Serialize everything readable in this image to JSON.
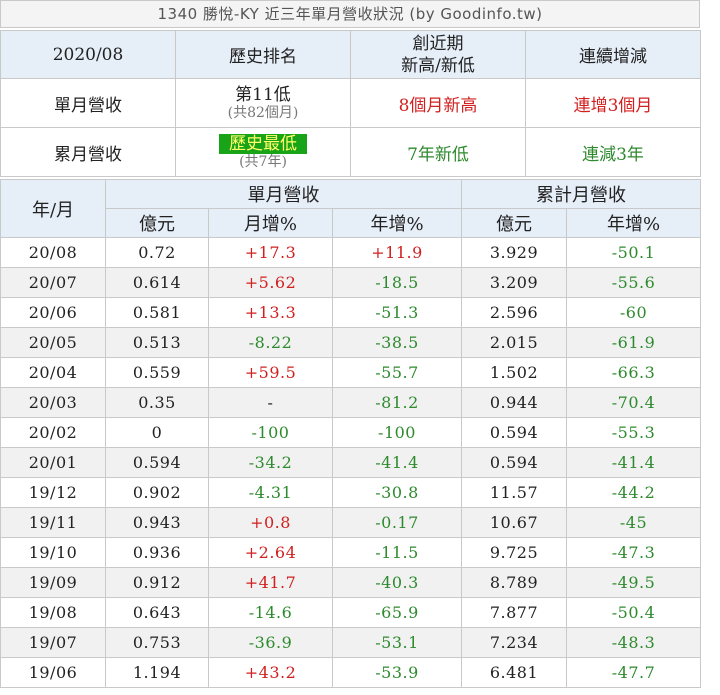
{
  "title": "1340 勝悅-KY 近三年單月營收狀況 (by Goodinfo.tw)",
  "summary": {
    "period": "2020/08",
    "headers": [
      "歷史排名",
      "創近期\n新高/新低",
      "連續增減"
    ],
    "header_line1": "創近期",
    "header_line2": "新高/新低",
    "monthly": {
      "label": "單月營收",
      "rank_main": "第11低",
      "rank_sub": "(共82個月)",
      "recent": "8個月新高",
      "streak": "連增3個月"
    },
    "cumulative": {
      "label": "累月營收",
      "rank_main": "歷史最低",
      "rank_sub": "(共7年)",
      "recent": "7年新低",
      "streak": "連減3年"
    }
  },
  "table": {
    "col_period": "年/月",
    "group_monthly": "單月營收",
    "group_cumulative": "累計月營收",
    "sub_headers": [
      "億元",
      "月增%",
      "年增%",
      "億元",
      "年增%"
    ],
    "rows": [
      {
        "period": "20/08",
        "rev": "0.72",
        "mom": "+17.3",
        "yoy": "+11.9",
        "cum": "3.929",
        "cum_yoy": "-50.1"
      },
      {
        "period": "20/07",
        "rev": "0.614",
        "mom": "+5.62",
        "yoy": "-18.5",
        "cum": "3.209",
        "cum_yoy": "-55.6"
      },
      {
        "period": "20/06",
        "rev": "0.581",
        "mom": "+13.3",
        "yoy": "-51.3",
        "cum": "2.596",
        "cum_yoy": "-60"
      },
      {
        "period": "20/05",
        "rev": "0.513",
        "mom": "-8.22",
        "yoy": "-38.5",
        "cum": "2.015",
        "cum_yoy": "-61.9"
      },
      {
        "period": "20/04",
        "rev": "0.559",
        "mom": "+59.5",
        "yoy": "-55.7",
        "cum": "1.502",
        "cum_yoy": "-66.3"
      },
      {
        "period": "20/03",
        "rev": "0.35",
        "mom": "-",
        "yoy": "-81.2",
        "cum": "0.944",
        "cum_yoy": "-70.4"
      },
      {
        "period": "20/02",
        "rev": "0",
        "mom": "-100",
        "yoy": "-100",
        "cum": "0.594",
        "cum_yoy": "-55.3"
      },
      {
        "period": "20/01",
        "rev": "0.594",
        "mom": "-34.2",
        "yoy": "-41.4",
        "cum": "0.594",
        "cum_yoy": "-41.4"
      },
      {
        "period": "19/12",
        "rev": "0.902",
        "mom": "-4.31",
        "yoy": "-30.8",
        "cum": "11.57",
        "cum_yoy": "-44.2"
      },
      {
        "period": "19/11",
        "rev": "0.943",
        "mom": "+0.8",
        "yoy": "-0.17",
        "cum": "10.67",
        "cum_yoy": "-45"
      },
      {
        "period": "19/10",
        "rev": "0.936",
        "mom": "+2.64",
        "yoy": "-11.5",
        "cum": "9.725",
        "cum_yoy": "-47.3"
      },
      {
        "period": "19/09",
        "rev": "0.912",
        "mom": "+41.7",
        "yoy": "-40.3",
        "cum": "8.789",
        "cum_yoy": "-49.5"
      },
      {
        "period": "19/08",
        "rev": "0.643",
        "mom": "-14.6",
        "yoy": "-65.9",
        "cum": "7.877",
        "cum_yoy": "-50.4"
      },
      {
        "period": "19/07",
        "rev": "0.753",
        "mom": "-36.9",
        "yoy": "-53.1",
        "cum": "7.234",
        "cum_yoy": "-48.3"
      },
      {
        "period": "19/06",
        "rev": "1.194",
        "mom": "+43.2",
        "yoy": "-53.9",
        "cum": "6.481",
        "cum_yoy": "-47.7"
      }
    ]
  },
  "colors": {
    "positive": "#d21f1f",
    "negative": "#2d8a2d",
    "header_bg": "#e6eef8",
    "highlight_bg": "#19a319",
    "highlight_text": "#ffff66"
  }
}
